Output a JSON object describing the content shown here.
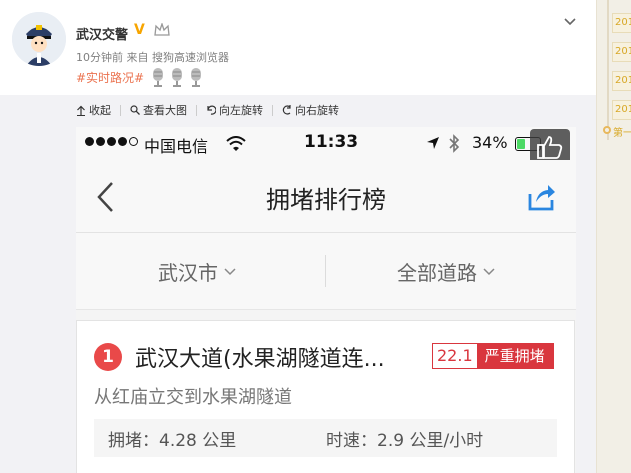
{
  "post": {
    "username": "武汉交警",
    "verified_mark": "V",
    "meta": "10分钟前 来自 搜狗高速浏览器",
    "topic": "#实时路况#"
  },
  "toolbar": {
    "collapse": "收起",
    "view_large": "查看大图",
    "rotate_left": "向左旋转",
    "rotate_right": "向右旋转"
  },
  "app": {
    "status": {
      "carrier": "中国电信",
      "time": "11:33",
      "battery": "34%"
    },
    "title": "拥堵排行榜",
    "filters": {
      "city": "武汉市",
      "road": "全部道路"
    },
    "ranking": [
      {
        "rank": "1",
        "road": "武汉大道(水果湖隧道连...",
        "index": "22.1",
        "status": "严重拥堵",
        "section": "从红庙立交到水果湖隧道",
        "jam": "拥堵：4.28 公里",
        "speed": "时速：2.9 公里/小时"
      }
    ]
  },
  "sidebar": {
    "years": [
      "201",
      "201",
      "201",
      "201"
    ],
    "more": "第一"
  },
  "colors": {
    "topic": "#eb7350",
    "congestion_red": "#d9363e",
    "rank_red": "#e94949",
    "share_blue": "#2a86e0",
    "sidebar_gold": "#d8a826"
  },
  "icons": [
    "police-avatar-icon",
    "verified-icon",
    "crown-icon",
    "chevron-down-icon",
    "microphone-emoji-icon",
    "collapse-icon",
    "search-icon",
    "rotate-left-icon",
    "rotate-right-icon",
    "wifi-icon",
    "location-arrow-icon",
    "bluetooth-icon",
    "battery-icon",
    "thumbs-up-icon",
    "back-icon",
    "share-icon"
  ]
}
